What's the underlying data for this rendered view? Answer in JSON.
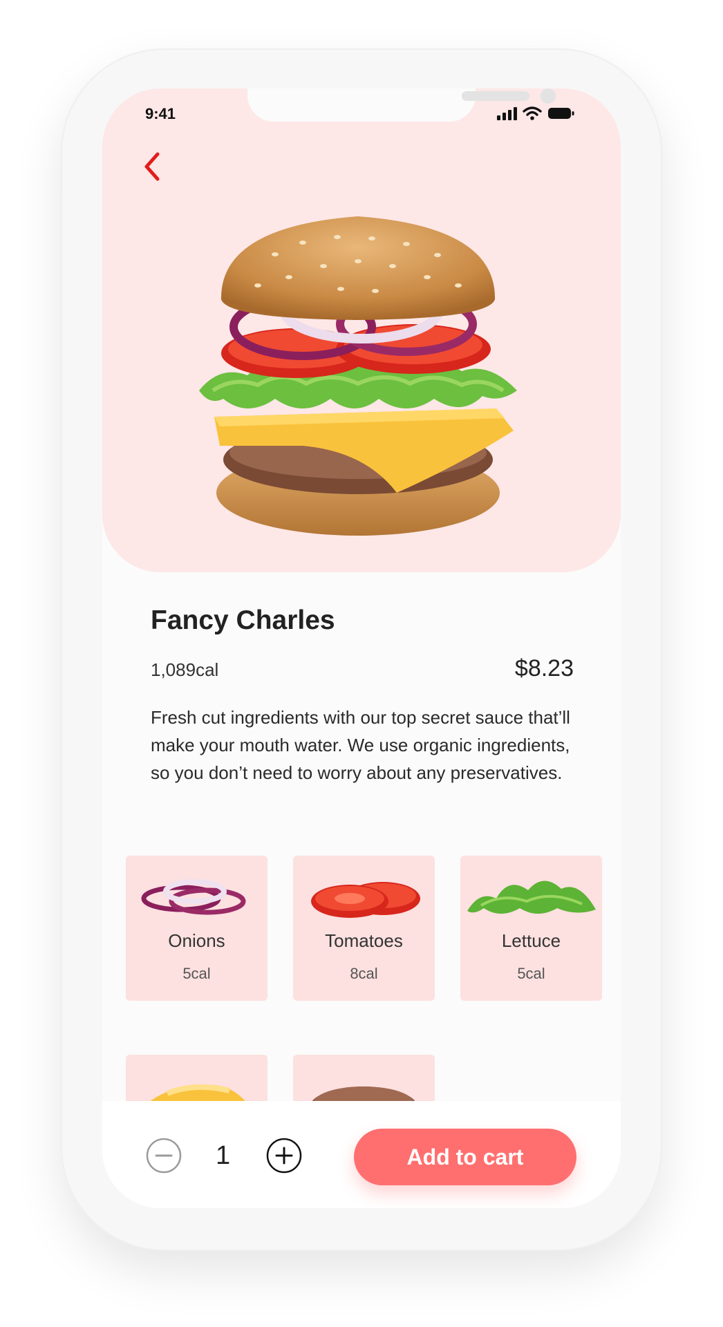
{
  "status_bar": {
    "time": "9:41"
  },
  "product": {
    "name": "Fancy Charles",
    "calories": "1,089cal",
    "price": "$8.23",
    "description": "Fresh cut ingredients with our top secret sauce that’ll make your mouth water. We use organic ingredients, so you don’t need to worry about any preservatives."
  },
  "ingredients": [
    {
      "name": "Onions",
      "calories": "5cal"
    },
    {
      "name": "Tomatoes",
      "calories": "8cal"
    },
    {
      "name": "Lettuce",
      "calories": "5cal"
    }
  ],
  "cart": {
    "quantity": "1",
    "add_label": "Add to cart"
  },
  "colors": {
    "accent": "#ff6f6f",
    "hero_bg": "#fde7e7",
    "card_bg": "#fde0e0",
    "back_arrow": "#e31b1b"
  }
}
